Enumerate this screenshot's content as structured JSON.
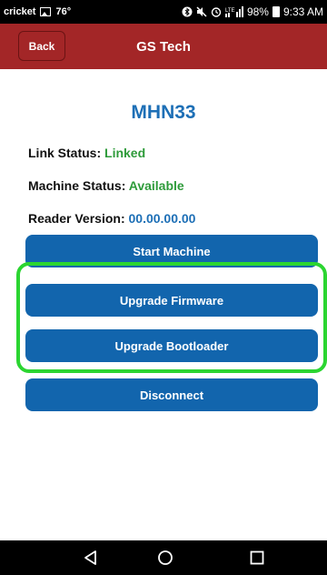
{
  "status_bar": {
    "carrier": "cricket",
    "temperature": "76°",
    "battery_percent": "98%",
    "time": "9:33 AM",
    "icons": [
      "image-icon",
      "bluetooth-icon",
      "mute-icon",
      "alarm-icon",
      "lte-signal-icon",
      "battery-icon"
    ]
  },
  "header": {
    "back_label": "Back",
    "title": "GS Tech",
    "color": "#a32627"
  },
  "device": {
    "name": "MHN33"
  },
  "info": {
    "link_status_label": "Link Status:",
    "link_status_value": "Linked",
    "machine_status_label": "Machine Status:",
    "machine_status_value": "Available",
    "reader_version_label": "Reader Version:",
    "reader_version_value": "00.00.00.00"
  },
  "buttons": {
    "start_machine": "Start Machine",
    "upgrade_firmware": "Upgrade Firmware",
    "upgrade_bootloader": "Upgrade Bootloader",
    "disconnect": "Disconnect"
  },
  "colors": {
    "button": "#1265ad",
    "status_green": "#2e9b3a",
    "accent_blue": "#1d6fb6",
    "highlight": "#2bd531"
  },
  "nav": {
    "icons": [
      "back-triangle-icon",
      "home-circle-icon",
      "recents-square-icon"
    ]
  }
}
